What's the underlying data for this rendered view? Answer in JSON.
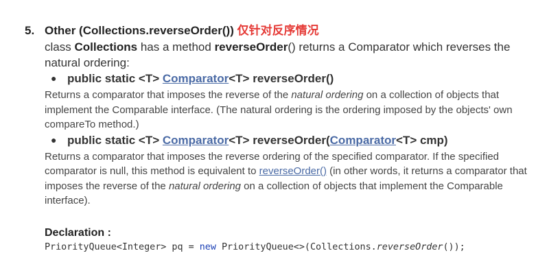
{
  "heading": {
    "number": "5.",
    "title": "Other (Collections.reverseOrder())",
    "note_cn": "仅针对反序情况"
  },
  "intro": {
    "p1": "class ",
    "class_name": "Collections",
    "p2": " has a method ",
    "method_name": "reverseOrder",
    "p3": "() returns a Comparator which reverses the natural ordering:"
  },
  "methods": [
    {
      "bullet": "●",
      "prefix": "public static <T> ",
      "link": "Comparator",
      "suffix": "<T> reverseOrder()",
      "desc": {
        "a": "Returns a comparator that imposes the reverse of the ",
        "italic": "natural ordering",
        "b": " on a collection of objects that implement the Comparable interface. (The natural ordering is the ordering imposed by the objects' own compareTo method.)"
      }
    },
    {
      "bullet": "●",
      "prefix": "public static <T> ",
      "link": "Comparator",
      "middle": "<T> reverseOrder(",
      "link2": "Comparator",
      "suffix": "<T> cmp)",
      "desc": {
        "a": "Returns a comparator that imposes the reverse ordering of the specified comparator. If the specified comparator is null, this method is equivalent to ",
        "link": "reverseOrder()",
        "b": " (in other words, it returns a comparator that imposes the reverse of the ",
        "italic": "natural ordering",
        "c": " on a collection of objects that implement the Comparable interface)."
      }
    }
  ],
  "declaration": {
    "title": "Declaration :",
    "code_a": "PriorityQueue<Integer> pq = ",
    "code_kw": "new",
    "code_b": " PriorityQueue<>(Collections.",
    "code_it": "reverseOrder",
    "code_c": "());"
  }
}
